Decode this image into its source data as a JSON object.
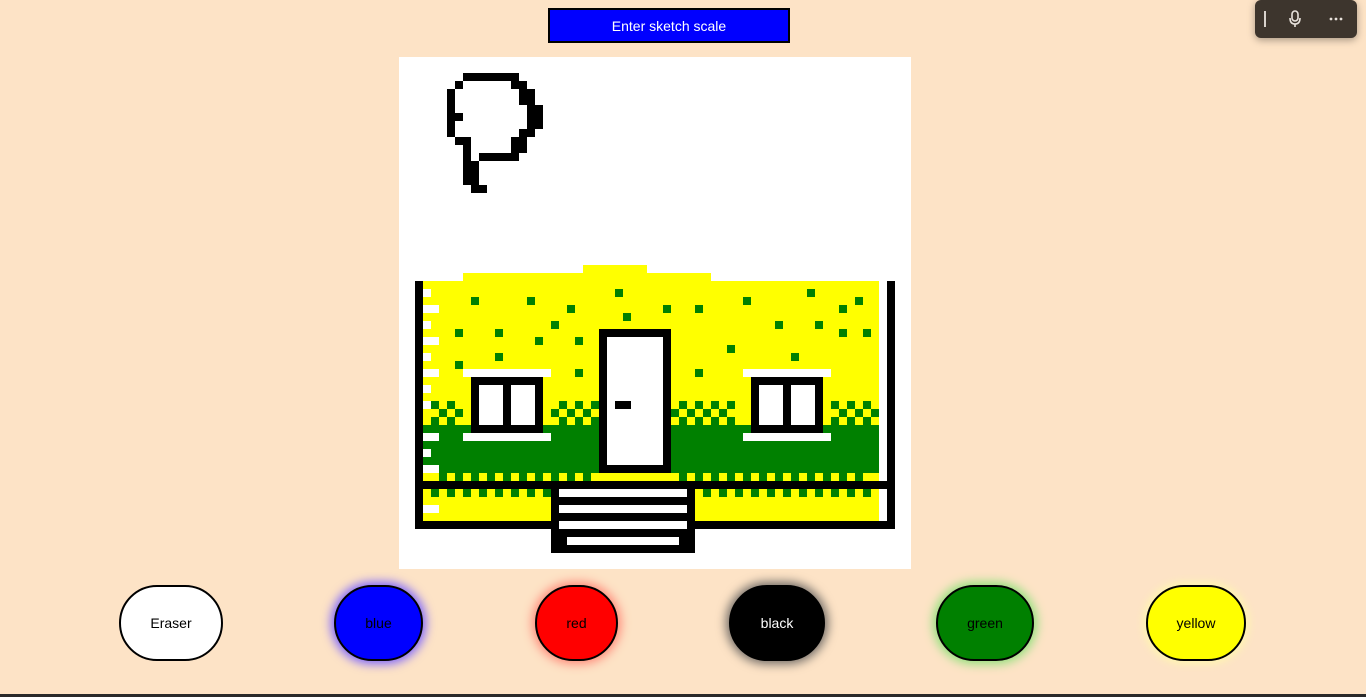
{
  "toolbar": {
    "scale_button_label": "Enter sketch scale"
  },
  "voice_bar": {
    "icons": [
      "drag-handle-icon",
      "microphone-icon",
      "more-options-icon"
    ]
  },
  "canvas": {
    "background": "#ffffff",
    "drawing": "pixel-sketch"
  },
  "palette": {
    "eraser": {
      "label": "Eraser",
      "color": "#ffffff"
    },
    "blue": {
      "label": "blue",
      "color": "#0000ff"
    },
    "red": {
      "label": "red",
      "color": "#ff0000"
    },
    "black": {
      "label": "black",
      "color": "#000000"
    },
    "green": {
      "label": "green",
      "color": "#008000"
    },
    "yellow": {
      "label": "yellow",
      "color": "#ffff00"
    }
  },
  "colors": {
    "page_background": "#fde3c6"
  }
}
